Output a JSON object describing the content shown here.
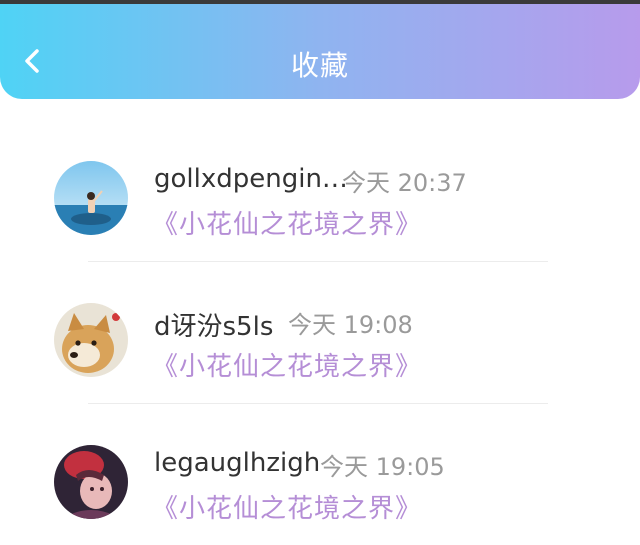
{
  "header": {
    "title": "收藏",
    "back_icon": "chevron-left-icon"
  },
  "favorites": [
    {
      "user": "gollxdpengin…",
      "time": "今天 20:37",
      "book": "《小花仙之花境之界》",
      "avatar": "beach-photo-avatar"
    },
    {
      "user": "d讶汾s5ls",
      "time": "今天 19:08",
      "book": "《小花仙之花境之界》",
      "avatar": "shiba-dog-avatar"
    },
    {
      "user": "legauglhzigh",
      "time": "今天 19:05",
      "book": "《小花仙之花境之界》",
      "avatar": "anime-character-avatar"
    }
  ],
  "colors": {
    "header_gradient_start": "#4fd3f5",
    "header_gradient_end": "#b79bec",
    "book_title": "#b58ed6",
    "time": "#9a9a9a"
  }
}
